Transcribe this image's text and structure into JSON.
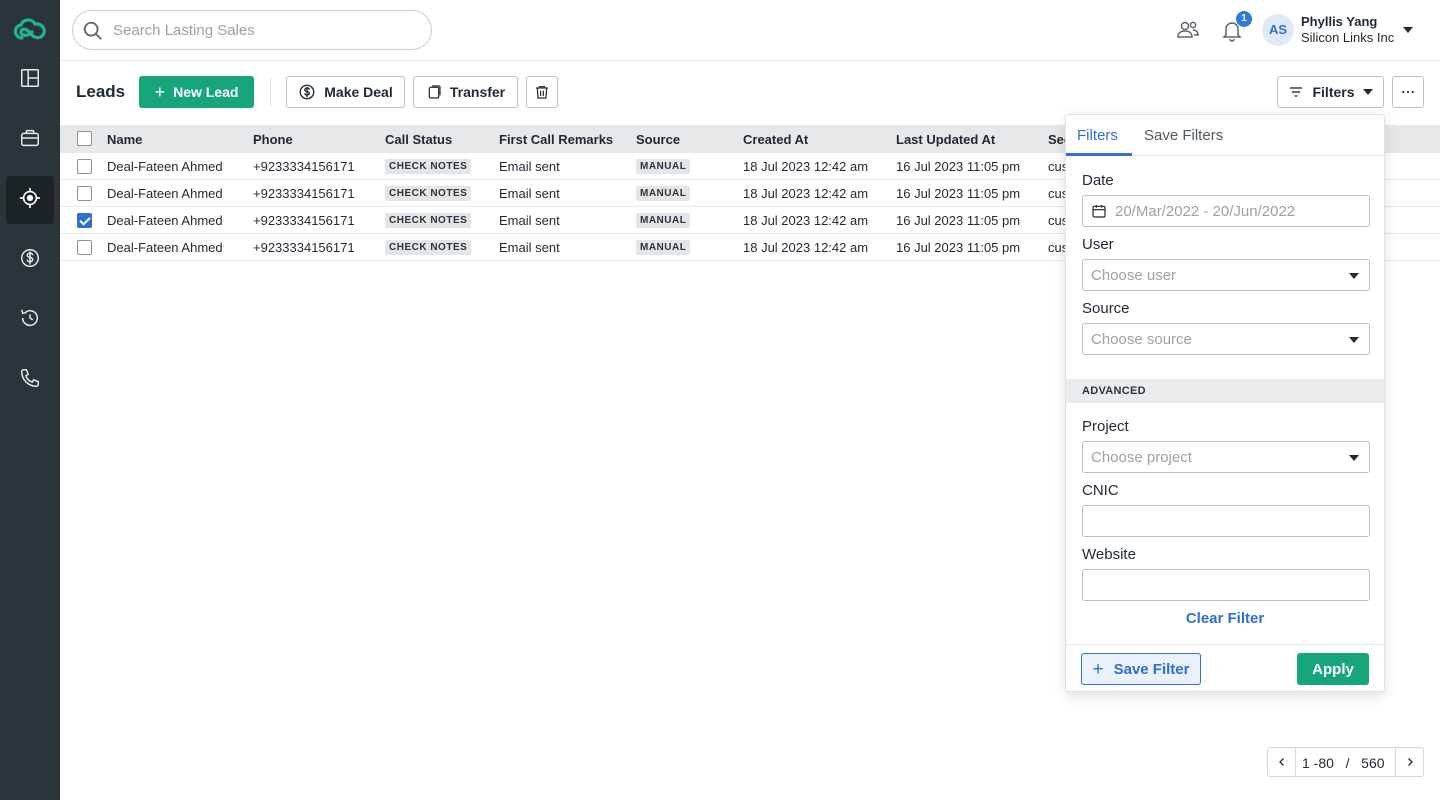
{
  "sidebar": {
    "logo": "cloud-link-logo",
    "items": [
      {
        "name": "dashboard",
        "icon": "dashboard-icon"
      },
      {
        "name": "inventory",
        "icon": "briefcase-icon"
      },
      {
        "name": "leads",
        "icon": "target-icon",
        "active": true
      },
      {
        "name": "deals",
        "icon": "dollar-icon"
      },
      {
        "name": "activity",
        "icon": "history-icon"
      },
      {
        "name": "calls",
        "icon": "phone-icon"
      }
    ]
  },
  "header": {
    "search_placeholder": "Search Lasting Sales",
    "notification_count": "1",
    "avatar_initials": "AS",
    "user_name": "Phyllis Yang",
    "user_org": "Silicon Links Inc"
  },
  "toolbar": {
    "title": "Leads",
    "new_lead": "New Lead",
    "make_deal": "Make Deal",
    "transfer": "Transfer",
    "filters": "Filters"
  },
  "table": {
    "columns": [
      "Name",
      "Phone",
      "Call Status",
      "First Call Remarks",
      "Source",
      "Created At",
      "Last Updated At",
      "Sec"
    ],
    "rows": [
      {
        "checked": false,
        "name": "Deal-Fateen Ahmed",
        "phone": "+9233334156171",
        "call_status": "CHECK NOTES",
        "remarks": "Email sent",
        "source": "MANUAL",
        "created": "18 Jul 2023 12:42 am",
        "updated": "16 Jul 2023 11:05 pm",
        "extra": "cus"
      },
      {
        "checked": false,
        "name": "Deal-Fateen Ahmed",
        "phone": "+9233334156171",
        "call_status": "CHECK NOTES",
        "remarks": "Email sent",
        "source": "MANUAL",
        "created": "18 Jul 2023 12:42 am",
        "updated": "16 Jul 2023 11:05 pm",
        "extra": "cus"
      },
      {
        "checked": true,
        "name": "Deal-Fateen Ahmed",
        "phone": "+9233334156171",
        "call_status": "CHECK NOTES",
        "remarks": "Email sent",
        "source": "MANUAL",
        "created": "18 Jul 2023 12:42 am",
        "updated": "16 Jul 2023 11:05 pm",
        "extra": "cus"
      },
      {
        "checked": false,
        "name": "Deal-Fateen Ahmed",
        "phone": "+9233334156171",
        "call_status": "CHECK NOTES",
        "remarks": "Email sent",
        "source": "MANUAL",
        "created": "18 Jul 2023 12:42 am",
        "updated": "16 Jul 2023 11:05 pm",
        "extra": "cus"
      }
    ]
  },
  "filters_panel": {
    "tab_filters": "Filters",
    "tab_save_filters": "Save Filters",
    "date_label": "Date",
    "date_placeholder": "20/Mar/2022 - 20/Jun/2022",
    "user_label": "User",
    "user_placeholder": "Choose user",
    "source_label": "Source",
    "source_placeholder": "Choose source",
    "advanced": "ADVANCED",
    "project_label": "Project",
    "project_placeholder": "Choose project",
    "cnic_label": "CNIC",
    "cnic_value": "",
    "website_label": "Website",
    "website_value": "",
    "clear": "Clear Filter",
    "save_filter": "Save Filter",
    "apply": "Apply"
  },
  "pagination": {
    "range": "1 -80",
    "separator": "/",
    "total": "560"
  },
  "colors": {
    "sidebar_bg": "#2b3439",
    "primary_green": "#17a57a",
    "accent_blue": "#2f6fd1",
    "logo_teal": "#1fb58f"
  }
}
